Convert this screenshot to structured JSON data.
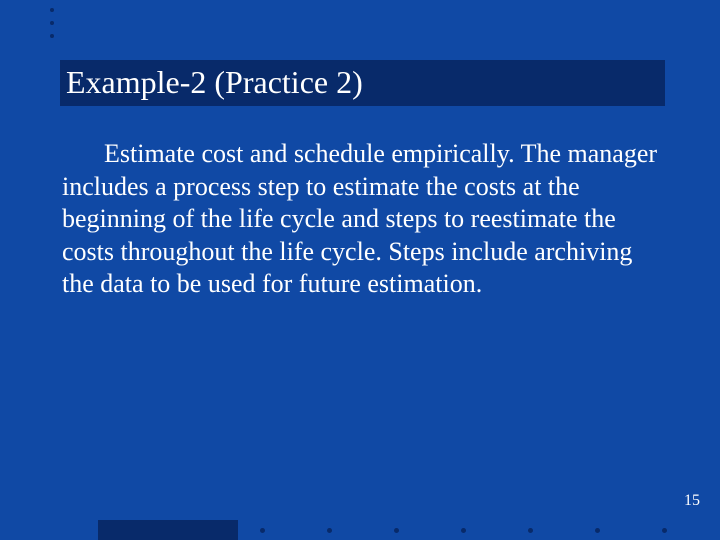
{
  "slide": {
    "title": "Example-2 (Practice 2)",
    "body": "Estimate cost and schedule empirically. The manager includes a process step to estimate the costs at the beginning of the life cycle and steps to reestimate the costs throughout the life cycle. Steps include archiving the data to be used for future estimation.",
    "page_number": "15"
  }
}
